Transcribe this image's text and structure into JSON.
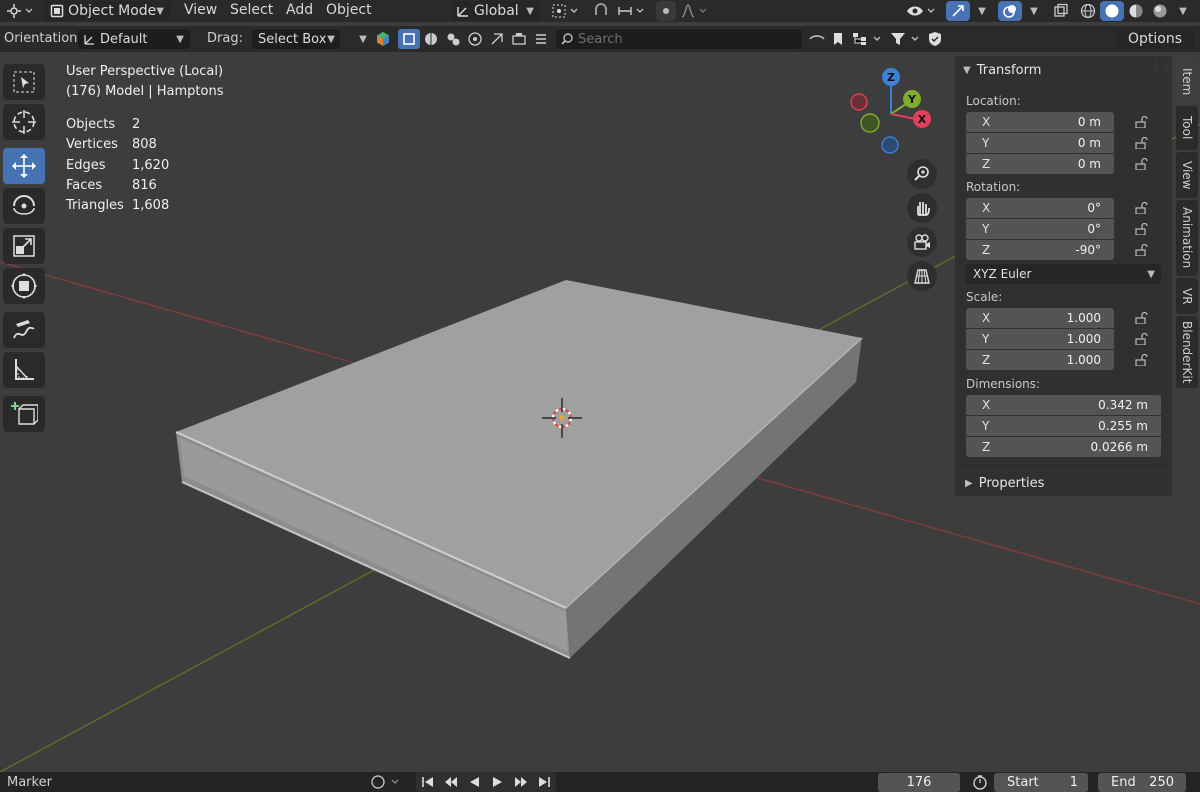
{
  "header": {
    "mode": "Object Mode",
    "menus": [
      "View",
      "Select",
      "Add",
      "Object"
    ],
    "transform_orientation": "Global"
  },
  "tool_header": {
    "orientation_label": "Orientation:",
    "orientation_value": "Default",
    "drag_label": "Drag:",
    "drag_value": "Select Box",
    "search_placeholder": "Search",
    "options_label": "Options"
  },
  "viewport": {
    "view_name": "User Perspective (Local)",
    "collection_info": "(176) Model | Hamptons",
    "stats": [
      {
        "label": "Objects",
        "value": "2"
      },
      {
        "label": "Vertices",
        "value": "808"
      },
      {
        "label": "Edges",
        "value": "1,620"
      },
      {
        "label": "Faces",
        "value": "816"
      },
      {
        "label": "Triangles",
        "value": "1,608"
      }
    ],
    "gizmo_axes": {
      "x": "X",
      "y": "Y",
      "z": "Z"
    }
  },
  "npanel": {
    "transform_title": "Transform",
    "location_label": "Location:",
    "location": [
      {
        "axis": "X",
        "value": "0 m"
      },
      {
        "axis": "Y",
        "value": "0 m"
      },
      {
        "axis": "Z",
        "value": "0 m"
      }
    ],
    "rotation_label": "Rotation:",
    "rotation": [
      {
        "axis": "X",
        "value": "0°"
      },
      {
        "axis": "Y",
        "value": "0°"
      },
      {
        "axis": "Z",
        "value": "-90°"
      }
    ],
    "rotation_mode": "XYZ Euler",
    "scale_label": "Scale:",
    "scale": [
      {
        "axis": "X",
        "value": "1.000"
      },
      {
        "axis": "Y",
        "value": "1.000"
      },
      {
        "axis": "Z",
        "value": "1.000"
      }
    ],
    "dimensions_label": "Dimensions:",
    "dimensions": [
      {
        "axis": "X",
        "value": "0.342 m"
      },
      {
        "axis": "Y",
        "value": "0.255 m"
      },
      {
        "axis": "Z",
        "value": "0.0266 m"
      }
    ],
    "properties_title": "Properties"
  },
  "sidebar_tabs": [
    "Item",
    "Tool",
    "View",
    "Animation",
    "VR",
    "BlenderKit"
  ],
  "timeline": {
    "marker_label": "Marker",
    "current_frame": "176",
    "start_label": "Start",
    "start_value": "1",
    "end_label": "End",
    "end_value": "250"
  },
  "colors": {
    "accent": "#4772b3",
    "axis_x": "#e0405a",
    "axis_y": "#7fae2e",
    "axis_z": "#3d80d8",
    "viewport_bg": "#3d3d3d",
    "panel_bg": "#303030"
  },
  "icons": [
    "editor-type-icon",
    "object-mode-icon",
    "orientation-icon",
    "pivot-icon",
    "snap-icon",
    "proportional-icon",
    "visibility-icon",
    "gizmo-icon",
    "overlay-icon",
    "xray-icon",
    "shading-wireframe-icon",
    "shading-solid-icon",
    "shading-material-icon",
    "shading-rendered-icon",
    "select-box-icon",
    "cursor-icon",
    "move-icon",
    "rotate-icon",
    "scale-icon",
    "transform-icon",
    "annotate-icon",
    "measure-icon",
    "add-cube-icon",
    "zoom-icon",
    "pan-hand-icon",
    "camera-icon",
    "perspective-grid-icon",
    "lock-icon"
  ]
}
